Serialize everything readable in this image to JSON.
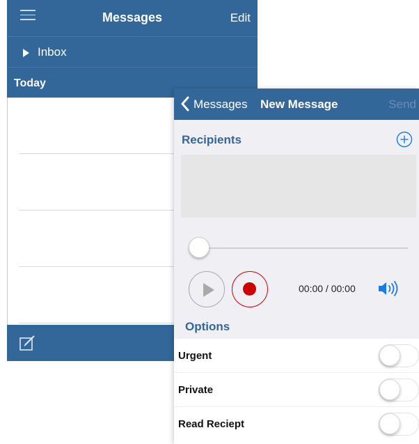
{
  "back_screen": {
    "navbar": {
      "title": "Messages",
      "edit_label": "Edit"
    },
    "inbox": {
      "label": "Inbox"
    },
    "section": {
      "label": "Today"
    }
  },
  "front_screen": {
    "navbar": {
      "back_label": "Messages",
      "title": "New Message",
      "send_label": "Send"
    },
    "recipients": {
      "label": "Recipients"
    },
    "player": {
      "progress": 0,
      "time": "00:00 / 00:00"
    },
    "options": {
      "label": "Options",
      "items": [
        {
          "label": "Urgent",
          "on": false
        },
        {
          "label": "Private",
          "on": false
        },
        {
          "label": "Read Reciept",
          "on": false
        }
      ]
    }
  },
  "colors": {
    "brand": "#336699",
    "record": "#cc0000",
    "volume": "#1a7ae6"
  },
  "icons": [
    "hamburger-icon",
    "disclosure-triangle-icon",
    "compose-icon",
    "chevron-left-icon",
    "plus-circle-icon",
    "play-icon",
    "record-icon",
    "speaker-volume-icon"
  ]
}
